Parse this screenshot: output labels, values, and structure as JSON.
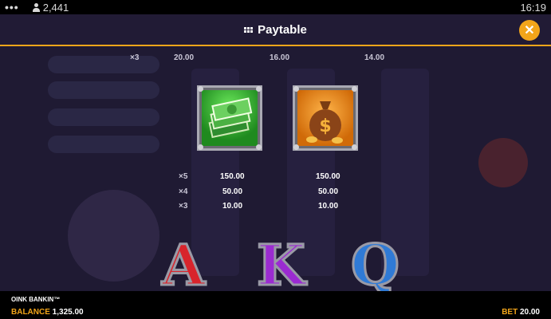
{
  "status_bar": {
    "player_count": "2,441",
    "time": "16:19"
  },
  "header": {
    "title": "Paytable"
  },
  "top_row": {
    "mult": "×3",
    "values": [
      "20.00",
      "16.00",
      "14.00"
    ]
  },
  "symbols": [
    {
      "icon": "cash-stack-icon",
      "pays": [
        {
          "mult": "×5",
          "value": "150.00"
        },
        {
          "mult": "×4",
          "value": "50.00"
        },
        {
          "mult": "×3",
          "value": "10.00"
        }
      ]
    },
    {
      "icon": "money-bag-icon",
      "pays": [
        {
          "mult": "×5",
          "value": "150.00"
        },
        {
          "mult": "×4",
          "value": "50.00"
        },
        {
          "mult": "×3",
          "value": "10.00"
        }
      ]
    }
  ],
  "letters": [
    "A",
    "K",
    "Q"
  ],
  "footer": {
    "game_name": "OINK BANKIN™",
    "balance_label": "BALANCE",
    "balance_value": "1,325.00",
    "bet_label": "BET",
    "bet_value": "20.00"
  },
  "colors": {
    "accent": "#f2a51a",
    "background": "#1f1a33"
  }
}
